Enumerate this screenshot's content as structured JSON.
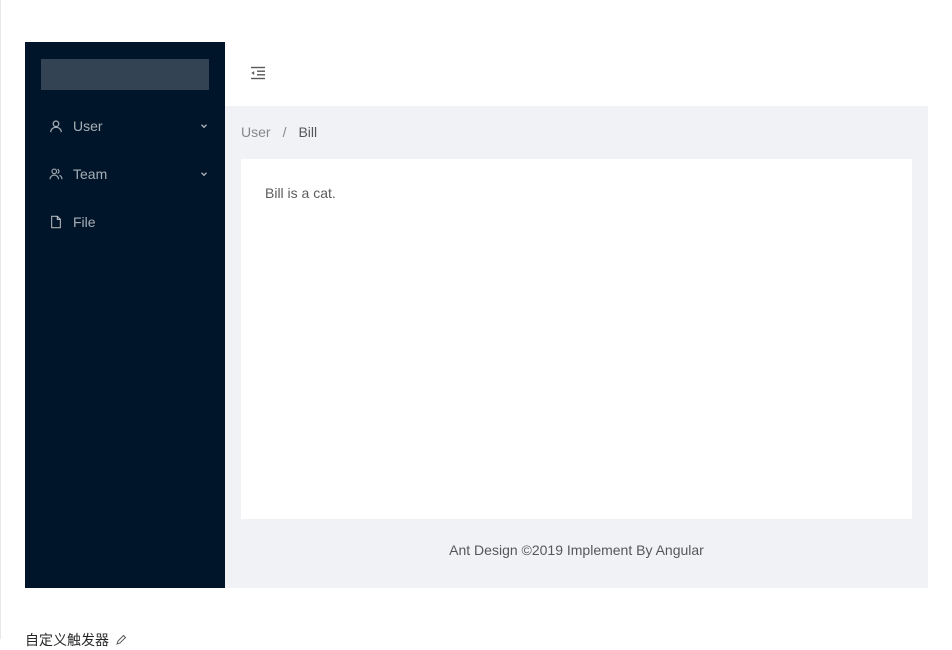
{
  "sider": {
    "menu": [
      {
        "label": "User",
        "icon": "user-icon",
        "has_children": true
      },
      {
        "label": "Team",
        "icon": "team-icon",
        "has_children": true
      },
      {
        "label": "File",
        "icon": "file-icon",
        "has_children": false
      }
    ]
  },
  "header": {
    "trigger_icon": "menu-fold-icon"
  },
  "breadcrumb": {
    "items": [
      "User",
      "Bill"
    ],
    "separator": "/"
  },
  "content": {
    "text": "Bill is a cat."
  },
  "footer": {
    "text": "Ant Design ©2019 Implement By Angular"
  },
  "demo": {
    "title": "自定义触发器",
    "edit_icon": "edit-icon"
  },
  "colors": {
    "sider_bg": "#001529",
    "layout_bg": "#f0f2f5"
  }
}
